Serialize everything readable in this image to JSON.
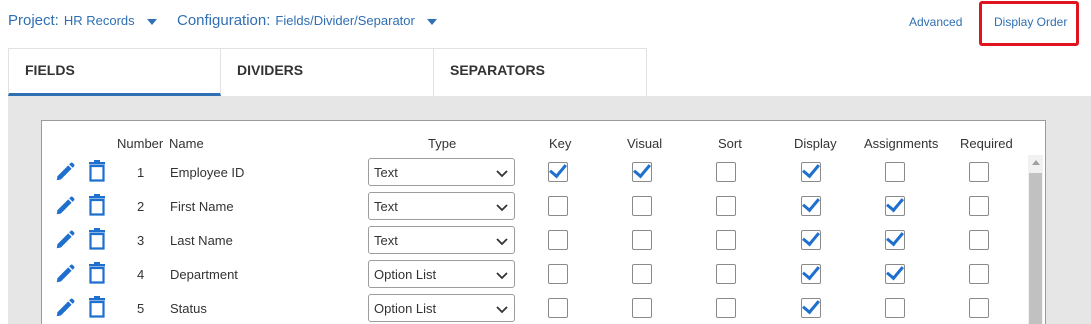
{
  "topbar": {
    "project_label": "Project:",
    "project_value": "HR Records",
    "config_label": "Configuration:",
    "config_value": "Fields/Divider/Separator",
    "advanced_label": "Advanced",
    "display_order_label": "Display Order"
  },
  "tabs": [
    {
      "label": "FIELDS",
      "active": true
    },
    {
      "label": "DIVIDERS",
      "active": false
    },
    {
      "label": "SEPARATORS",
      "active": false
    }
  ],
  "table": {
    "headers": {
      "number": "Number",
      "name": "Name",
      "type": "Type",
      "key": "Key",
      "visual": "Visual",
      "sort": "Sort",
      "display": "Display",
      "assignments": "Assignments",
      "required": "Required"
    },
    "rows": [
      {
        "number": "1",
        "name": "Employee ID",
        "type": "Text",
        "key": true,
        "visual": true,
        "sort": false,
        "display": true,
        "assignments": false,
        "required": false
      },
      {
        "number": "2",
        "name": "First Name",
        "type": "Text",
        "key": false,
        "visual": false,
        "sort": false,
        "display": true,
        "assignments": true,
        "required": false
      },
      {
        "number": "3",
        "name": "Last Name",
        "type": "Text",
        "key": false,
        "visual": false,
        "sort": false,
        "display": true,
        "assignments": true,
        "required": false
      },
      {
        "number": "4",
        "name": "Department",
        "type": "Option List",
        "key": false,
        "visual": false,
        "sort": false,
        "display": true,
        "assignments": true,
        "required": false
      },
      {
        "number": "5",
        "name": "Status",
        "type": "Option List",
        "key": false,
        "visual": false,
        "sort": false,
        "display": true,
        "assignments": false,
        "required": false
      }
    ]
  },
  "colors": {
    "accent": "#2f6fb3",
    "checkmark": "#1f6fce",
    "highlight_box": "#e0141e"
  },
  "icons": {
    "edit": "pencil-icon",
    "delete": "trash-icon",
    "dropdown": "chevron-down-icon"
  }
}
